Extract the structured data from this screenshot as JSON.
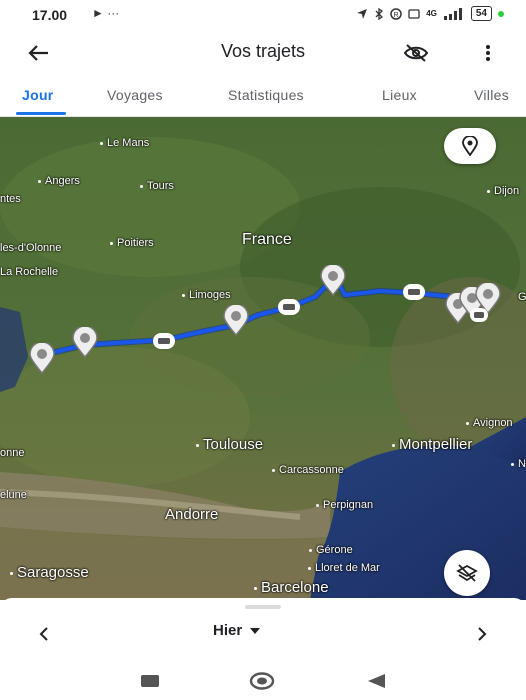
{
  "status_bar": {
    "time": "17.00",
    "left_icons": "► ···",
    "network": "4G",
    "battery": "54"
  },
  "app_bar": {
    "title": "Vos trajets",
    "back_icon": "arrow-back-icon",
    "hide_location_icon": "location-off-icon",
    "more_icon": "more-vert-icon"
  },
  "tabs": [
    {
      "label": "Jour",
      "active": true
    },
    {
      "label": "Voyages",
      "active": false
    },
    {
      "label": "Statistiques",
      "active": false
    },
    {
      "label": "Lieux",
      "active": false
    },
    {
      "label": "Villes",
      "active": false
    }
  ],
  "map": {
    "places": {
      "le_mans": "Le Mans",
      "nantes": "ntes",
      "angers": "Angers",
      "tours": "Tours",
      "dijon": "Dijon",
      "sables": "les-d'Olonne",
      "poitiers": "Poitiers",
      "france": "France",
      "la_rochelle": "La Rochelle",
      "limoges": "Limoges",
      "avignon": "Avignon",
      "toulouse": "Toulouse",
      "montpellier": "Montpellier",
      "bayonne": "onne",
      "carcassonne": "Carcassonne",
      "pamplune": "elune",
      "perpignan": "Perpignan",
      "andorre": "Andorre",
      "gerone": "Gérone",
      "lloret": "Lloret de Mar",
      "saragosse": "Saragosse",
      "barcelone": "Barcelone",
      "edge_g": "G",
      "edge_n": "N"
    },
    "route_color": "#1a56e8",
    "pin_icon": "place-pin-icon",
    "car_icon": "car-icon",
    "location_fab_icon": "my-location-pin-icon",
    "layers_fab_icon": "layers-off-icon"
  },
  "date_nav": {
    "label": "Hier",
    "prev_icon": "chevron-left-icon",
    "next_icon": "chevron-right-icon",
    "dropdown_icon": "caret-down-icon"
  },
  "android_nav": {
    "recents_icon": "square-icon",
    "home_icon": "circle-icon",
    "back_icon": "triangle-back-icon"
  }
}
